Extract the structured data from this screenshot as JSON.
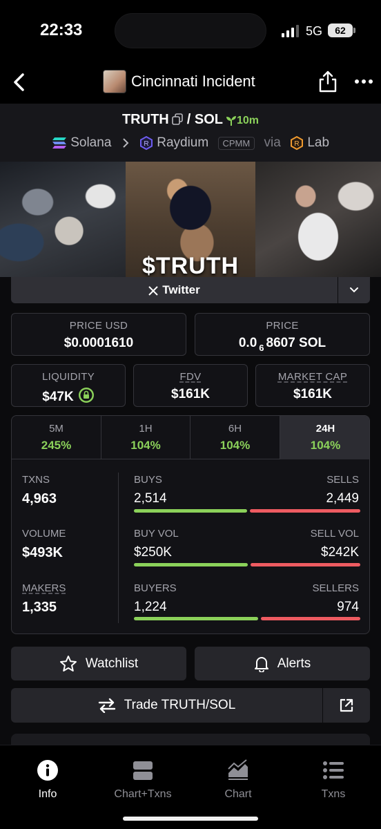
{
  "status_bar": {
    "time": "22:33",
    "network": "5G",
    "battery": "62"
  },
  "header": {
    "title": "Cincinnati Incident"
  },
  "pair": {
    "base": "TRUTH",
    "separator": "/",
    "quote": "SOL",
    "age": "10m",
    "chain": "Solana",
    "dex": "Raydium",
    "pool_type": "CPMM",
    "via_label": "via",
    "via": "Lab"
  },
  "banner": {
    "text": "$TRUTH"
  },
  "twitter": {
    "label": "Twitter"
  },
  "price": {
    "usd_label": "PRICE USD",
    "usd_value": "$0.0001610",
    "native_label": "PRICE",
    "native_prefix": "0.0",
    "native_zeros": "6",
    "native_digits": "8607 SOL"
  },
  "metrics": {
    "liquidity_label": "LIQUIDITY",
    "liquidity_value": "$47K",
    "fdv_label": "FDV",
    "fdv_value": "$161K",
    "mcap_label": "MARKET CAP",
    "mcap_value": "$161K"
  },
  "timeframes": [
    {
      "label": "5M",
      "change": "245%"
    },
    {
      "label": "1H",
      "change": "104%"
    },
    {
      "label": "6H",
      "change": "104%"
    },
    {
      "label": "24H",
      "change": "104%",
      "active": true
    }
  ],
  "stats": {
    "txns_label": "TXNS",
    "txns_value": "4,963",
    "volume_label": "VOLUME",
    "volume_value": "$493K",
    "makers_label": "MAKERS",
    "makers_value": "1,335",
    "buys_label": "BUYS",
    "buys_value": "2,514",
    "sells_label": "SELLS",
    "sells_value": "2,449",
    "buys_fraction": 0.507,
    "buyvol_label": "BUY VOL",
    "buyvol_value": "$250K",
    "sellvol_label": "SELL VOL",
    "sellvol_value": "$242K",
    "buyvol_fraction": 0.508,
    "buyers_label": "BUYERS",
    "buyers_value": "1,224",
    "sellers_label": "SELLERS",
    "sellers_value": "974",
    "buyers_fraction": 0.557
  },
  "actions": {
    "watchlist": "Watchlist",
    "alerts": "Alerts",
    "trade": "Trade TRUTH/SOL"
  },
  "colors": {
    "positive": "#8bd15a",
    "negative": "#ee5b61",
    "background": "#0b0b0d"
  },
  "bottom_nav": [
    {
      "label": "Info",
      "icon": "info-icon",
      "active": true
    },
    {
      "label": "Chart+Txns",
      "icon": "chart-txns-icon"
    },
    {
      "label": "Chart",
      "icon": "chart-icon"
    },
    {
      "label": "Txns",
      "icon": "list-icon"
    }
  ]
}
